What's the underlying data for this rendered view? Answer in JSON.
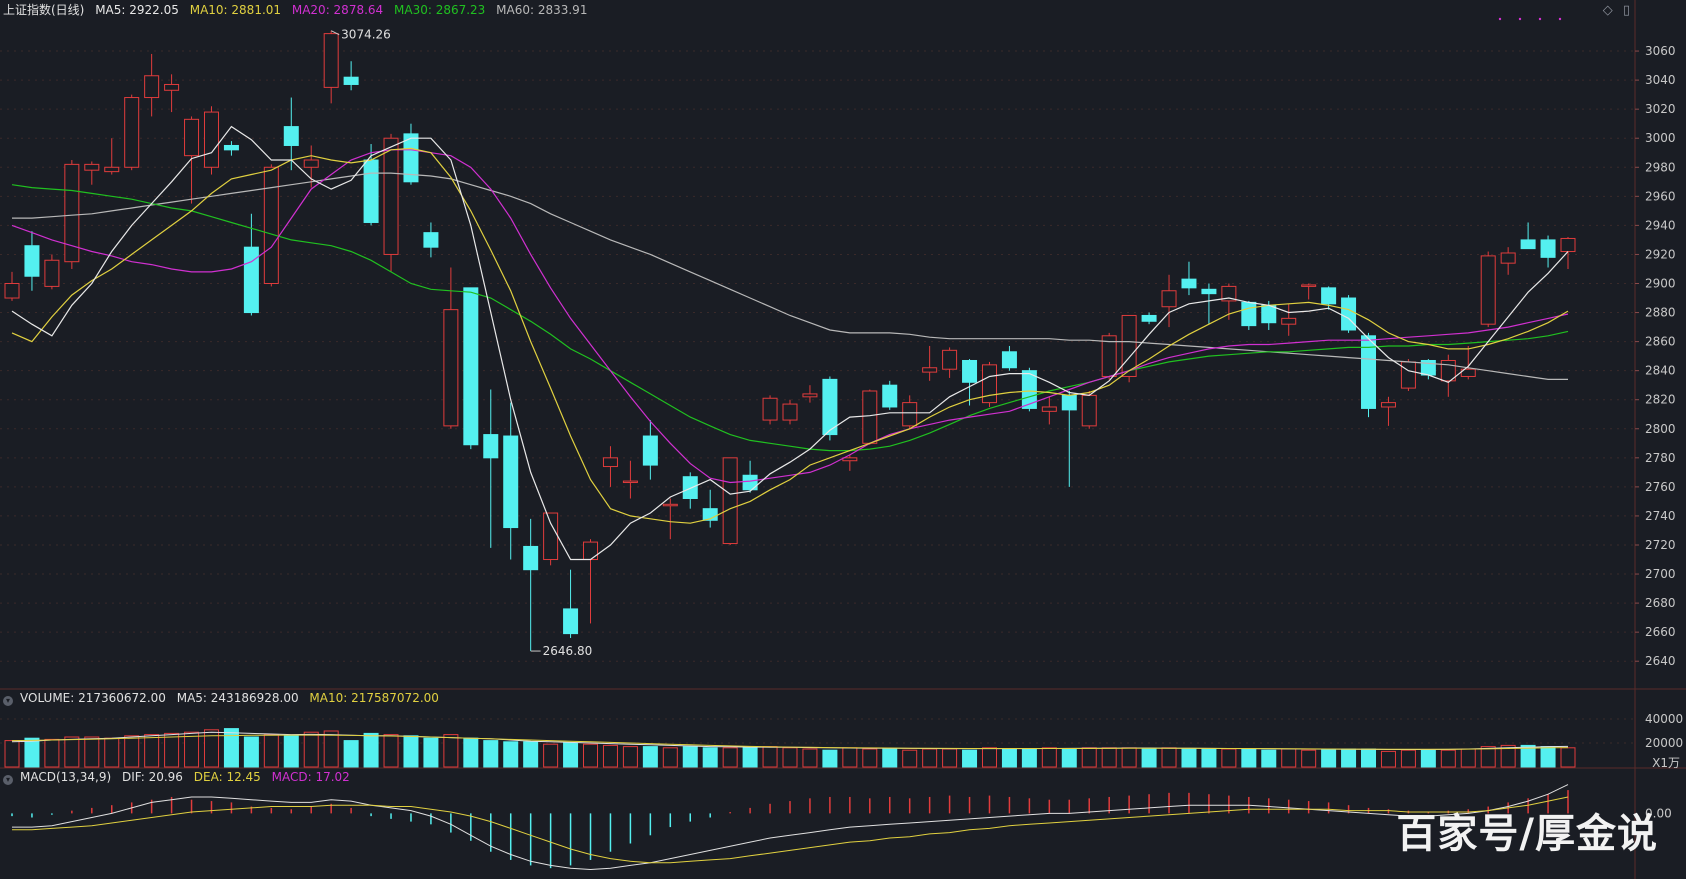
{
  "price_header": {
    "title": "上证指数(日线)",
    "ma5": "MA5: 2922.05",
    "ma10": "MA10: 2881.01",
    "ma20": "MA20: 2878.64",
    "ma30": "MA30: 2867.23",
    "ma60": "MA60: 2833.91"
  },
  "volume_header": {
    "title": "VOLUME: 217360672.00",
    "ma5": "MA5: 243186928.00",
    "ma10": "MA10: 217587072.00",
    "unit": "X1万"
  },
  "macd_header": {
    "title": "MACD(13,34,9)",
    "dif": "DIF: 20.96",
    "dea": "DEA: 12.45",
    "macd": "MACD: 17.02"
  },
  "annotations": {
    "high": "3074.26",
    "low": "2646.80"
  },
  "watermark": "百家号/厚金说",
  "colors": {
    "background": "#1a1d24",
    "up": "#e03c3c",
    "down": "#54f0f0",
    "ma5": "#e8e8e8",
    "ma10": "#e0d040",
    "ma20": "#d030d0",
    "ma30": "#20c020",
    "ma60": "#b8b8b8",
    "grid": "#3a2a2a"
  },
  "chart_data": {
    "type": "candlestick",
    "price_axis": {
      "ylim": [
        2625,
        3080
      ],
      "ticks": [
        3060,
        3040,
        3020,
        3000,
        2980,
        2960,
        2940,
        2920,
        2900,
        2880,
        2860,
        2840,
        2820,
        2800,
        2780,
        2760,
        2740,
        2720,
        2700,
        2680,
        2660,
        2640
      ]
    },
    "volume_axis": {
      "ylim": [
        0,
        50000
      ],
      "ticks": [
        40000,
        20000
      ]
    },
    "macd_axis": {
      "ylim": [
        -45,
        20
      ],
      "ticks": [
        0.0
      ]
    },
    "macd_tick_label": "0.00",
    "candles": [
      {
        "o": 2890,
        "h": 2908,
        "l": 2888,
        "c": 2900
      },
      {
        "o": 2926,
        "h": 2936,
        "l": 2895,
        "c": 2905
      },
      {
        "o": 2898,
        "h": 2920,
        "l": 2896,
        "c": 2916
      },
      {
        "o": 2915,
        "h": 2985,
        "l": 2910,
        "c": 2982
      },
      {
        "o": 2978,
        "h": 2984,
        "l": 2968,
        "c": 2982
      },
      {
        "o": 2977,
        "h": 3000,
        "l": 2975,
        "c": 2980
      },
      {
        "o": 2980,
        "h": 3030,
        "l": 2978,
        "c": 3028
      },
      {
        "o": 3028,
        "h": 3058,
        "l": 3015,
        "c": 3043
      },
      {
        "o": 3033,
        "h": 3044,
        "l": 3018,
        "c": 3037
      },
      {
        "o": 2988,
        "h": 3015,
        "l": 2955,
        "c": 3013
      },
      {
        "o": 2980,
        "h": 3022,
        "l": 2975,
        "c": 3018
      },
      {
        "o": 2995,
        "h": 2998,
        "l": 2988,
        "c": 2992
      },
      {
        "o": 2925,
        "h": 2948,
        "l": 2878,
        "c": 2880
      },
      {
        "o": 2900,
        "h": 2982,
        "l": 2898,
        "c": 2980
      },
      {
        "o": 3008,
        "h": 3028,
        "l": 2978,
        "c": 2995
      },
      {
        "o": 2980,
        "h": 2995,
        "l": 2966,
        "c": 2985
      },
      {
        "o": 3035,
        "h": 3074,
        "l": 3024,
        "c": 3072
      },
      {
        "o": 3042,
        "h": 3053,
        "l": 3033,
        "c": 3037
      },
      {
        "o": 2985,
        "h": 2996,
        "l": 2940,
        "c": 2942
      },
      {
        "o": 2920,
        "h": 3003,
        "l": 2908,
        "c": 3000
      },
      {
        "o": 3003,
        "h": 3010,
        "l": 2968,
        "c": 2970
      },
      {
        "o": 2935,
        "h": 2942,
        "l": 2918,
        "c": 2925
      },
      {
        "o": 2802,
        "h": 2911,
        "l": 2800,
        "c": 2882
      },
      {
        "o": 2897,
        "h": 2897,
        "l": 2786,
        "c": 2789
      },
      {
        "o": 2796,
        "h": 2827,
        "l": 2718,
        "c": 2780
      },
      {
        "o": 2795,
        "h": 2818,
        "l": 2710,
        "c": 2732
      },
      {
        "o": 2719,
        "h": 2738,
        "l": 2647,
        "c": 2703
      },
      {
        "o": 2710,
        "h": 2742,
        "l": 2706,
        "c": 2742
      },
      {
        "o": 2676,
        "h": 2703,
        "l": 2656,
        "c": 2659
      },
      {
        "o": 2710,
        "h": 2724,
        "l": 2666,
        "c": 2722
      },
      {
        "o": 2774,
        "h": 2788,
        "l": 2760,
        "c": 2780
      },
      {
        "o": 2763,
        "h": 2778,
        "l": 2752,
        "c": 2764
      },
      {
        "o": 2795,
        "h": 2806,
        "l": 2765,
        "c": 2775
      },
      {
        "o": 2747,
        "h": 2752,
        "l": 2724,
        "c": 2748
      },
      {
        "o": 2767,
        "h": 2770,
        "l": 2745,
        "c": 2752
      },
      {
        "o": 2745,
        "h": 2758,
        "l": 2732,
        "c": 2737
      },
      {
        "o": 2721,
        "h": 2780,
        "l": 2720,
        "c": 2780
      },
      {
        "o": 2768,
        "h": 2778,
        "l": 2756,
        "c": 2758
      },
      {
        "o": 2806,
        "h": 2823,
        "l": 2803,
        "c": 2821
      },
      {
        "o": 2806,
        "h": 2820,
        "l": 2803,
        "c": 2817
      },
      {
        "o": 2822,
        "h": 2830,
        "l": 2818,
        "c": 2824
      },
      {
        "o": 2834,
        "h": 2836,
        "l": 2792,
        "c": 2796
      },
      {
        "o": 2778,
        "h": 2782,
        "l": 2771,
        "c": 2780
      },
      {
        "o": 2790,
        "h": 2827,
        "l": 2789,
        "c": 2826
      },
      {
        "o": 2830,
        "h": 2833,
        "l": 2813,
        "c": 2815
      },
      {
        "o": 2802,
        "h": 2823,
        "l": 2800,
        "c": 2818
      },
      {
        "o": 2839,
        "h": 2857,
        "l": 2833,
        "c": 2842
      },
      {
        "o": 2841,
        "h": 2856,
        "l": 2835,
        "c": 2854
      },
      {
        "o": 2847,
        "h": 2848,
        "l": 2816,
        "c": 2832
      },
      {
        "o": 2818,
        "h": 2846,
        "l": 2815,
        "c": 2844
      },
      {
        "o": 2853,
        "h": 2857,
        "l": 2840,
        "c": 2842
      },
      {
        "o": 2840,
        "h": 2842,
        "l": 2812,
        "c": 2814
      },
      {
        "o": 2812,
        "h": 2822,
        "l": 2803,
        "c": 2815
      },
      {
        "o": 2823,
        "h": 2826,
        "l": 2760,
        "c": 2813
      },
      {
        "o": 2802,
        "h": 2826,
        "l": 2800,
        "c": 2823
      },
      {
        "o": 2836,
        "h": 2866,
        "l": 2834,
        "c": 2864
      },
      {
        "o": 2836,
        "h": 2878,
        "l": 2832,
        "c": 2878
      },
      {
        "o": 2878,
        "h": 2880,
        "l": 2872,
        "c": 2874
      },
      {
        "o": 2884,
        "h": 2906,
        "l": 2870,
        "c": 2895
      },
      {
        "o": 2903,
        "h": 2915,
        "l": 2892,
        "c": 2897
      },
      {
        "o": 2896,
        "h": 2900,
        "l": 2872,
        "c": 2893
      },
      {
        "o": 2888,
        "h": 2900,
        "l": 2875,
        "c": 2898
      },
      {
        "o": 2887,
        "h": 2888,
        "l": 2868,
        "c": 2871
      },
      {
        "o": 2885,
        "h": 2888,
        "l": 2868,
        "c": 2873
      },
      {
        "o": 2872,
        "h": 2886,
        "l": 2864,
        "c": 2876
      },
      {
        "o": 2898,
        "h": 2900,
        "l": 2889,
        "c": 2899
      },
      {
        "o": 2897,
        "h": 2898,
        "l": 2882,
        "c": 2886
      },
      {
        "o": 2890,
        "h": 2892,
        "l": 2866,
        "c": 2868
      },
      {
        "o": 2864,
        "h": 2866,
        "l": 2808,
        "c": 2814
      },
      {
        "o": 2815,
        "h": 2822,
        "l": 2802,
        "c": 2818
      },
      {
        "o": 2828,
        "h": 2848,
        "l": 2826,
        "c": 2846
      },
      {
        "o": 2847,
        "h": 2848,
        "l": 2834,
        "c": 2837
      },
      {
        "o": 2833,
        "h": 2851,
        "l": 2822,
        "c": 2847
      },
      {
        "o": 2836,
        "h": 2857,
        "l": 2834,
        "c": 2841
      },
      {
        "o": 2872,
        "h": 2922,
        "l": 2870,
        "c": 2919
      },
      {
        "o": 2914,
        "h": 2925,
        "l": 2906,
        "c": 2921
      },
      {
        "o": 2930,
        "h": 2942,
        "l": 2924,
        "c": 2924
      },
      {
        "o": 2930,
        "h": 2933,
        "l": 2911,
        "c": 2918
      },
      {
        "o": 2922,
        "h": 2932,
        "l": 2910,
        "c": 2931
      }
    ],
    "ma5": [
      2881,
      2872,
      2864,
      2885,
      2900,
      2922,
      2940,
      2955,
      2970,
      2986,
      2990,
      3008,
      2999,
      2985,
      2985,
      2972,
      2965,
      2971,
      2988,
      2994,
      3000,
      3000,
      2985,
      2940,
      2880,
      2820,
      2770,
      2735,
      2710,
      2710,
      2720,
      2735,
      2742,
      2753,
      2759,
      2765,
      2755,
      2757,
      2769,
      2777,
      2786,
      2799,
      2808,
      2809,
      2811,
      2811,
      2811,
      2822,
      2829,
      2836,
      2838,
      2838,
      2832,
      2825,
      2823,
      2833,
      2849,
      2865,
      2880,
      2886,
      2888,
      2890,
      2887,
      2885,
      2880,
      2881,
      2883,
      2876,
      2862,
      2849,
      2840,
      2837,
      2832,
      2843,
      2860,
      2877,
      2894,
      2907,
      2922
    ],
    "ma10": [
      2866,
      2860,
      2877,
      2892,
      2902,
      2910,
      2920,
      2930,
      2940,
      2950,
      2962,
      2972,
      2975,
      2978,
      2985,
      2988,
      2985,
      2983,
      2985,
      2992,
      2993,
      2990,
      2973,
      2950,
      2923,
      2895,
      2860,
      2828,
      2795,
      2765,
      2745,
      2740,
      2738,
      2736,
      2735,
      2738,
      2745,
      2750,
      2758,
      2765,
      2775,
      2780,
      2785,
      2790,
      2795,
      2800,
      2808,
      2815,
      2820,
      2823,
      2825,
      2826,
      2825,
      2823,
      2825,
      2830,
      2840,
      2848,
      2857,
      2865,
      2872,
      2879,
      2883,
      2885,
      2886,
      2887,
      2885,
      2882,
      2875,
      2866,
      2860,
      2858,
      2855,
      2855,
      2858,
      2862,
      2867,
      2873,
      2881
    ],
    "ma20": [
      2940,
      2935,
      2930,
      2926,
      2922,
      2919,
      2915,
      2913,
      2910,
      2908,
      2908,
      2910,
      2915,
      2925,
      2945,
      2965,
      2975,
      2985,
      2990,
      2992,
      2992,
      2990,
      2988,
      2980,
      2965,
      2945,
      2920,
      2897,
      2876,
      2858,
      2840,
      2822,
      2805,
      2790,
      2776,
      2766,
      2763,
      2764,
      2766,
      2768,
      2770,
      2775,
      2782,
      2790,
      2796,
      2800,
      2803,
      2806,
      2808,
      2810,
      2812,
      2817,
      2822,
      2827,
      2832,
      2836,
      2840,
      2845,
      2849,
      2852,
      2855,
      2857,
      2858,
      2858,
      2859,
      2860,
      2861,
      2861,
      2861,
      2862,
      2863,
      2864,
      2865,
      2866,
      2868,
      2870,
      2873,
      2876,
      2879
    ],
    "ma30": [
      2968,
      2966,
      2965,
      2964,
      2962,
      2960,
      2958,
      2955,
      2952,
      2950,
      2946,
      2942,
      2938,
      2934,
      2930,
      2928,
      2926,
      2922,
      2916,
      2908,
      2900,
      2896,
      2895,
      2894,
      2890,
      2882,
      2874,
      2865,
      2855,
      2848,
      2840,
      2832,
      2824,
      2816,
      2808,
      2802,
      2796,
      2792,
      2790,
      2788,
      2786,
      2785,
      2785,
      2786,
      2788,
      2792,
      2797,
      2803,
      2809,
      2814,
      2818,
      2822,
      2826,
      2829,
      2832,
      2836,
      2840,
      2843,
      2846,
      2848,
      2850,
      2851,
      2852,
      2853,
      2853,
      2854,
      2855,
      2856,
      2856,
      2857,
      2857,
      2858,
      2858,
      2859,
      2860,
      2861,
      2862,
      2864,
      2867
    ],
    "ma60": [
      2945,
      2945,
      2946,
      2947,
      2948,
      2950,
      2952,
      2954,
      2956,
      2958,
      2960,
      2962,
      2964,
      2966,
      2968,
      2970,
      2972,
      2974,
      2976,
      2976,
      2975,
      2974,
      2972,
      2968,
      2964,
      2960,
      2955,
      2948,
      2942,
      2936,
      2930,
      2925,
      2920,
      2914,
      2908,
      2902,
      2896,
      2890,
      2884,
      2878,
      2873,
      2868,
      2866,
      2866,
      2866,
      2865,
      2863,
      2862,
      2862,
      2862,
      2862,
      2862,
      2862,
      2861,
      2861,
      2860,
      2860,
      2859,
      2858,
      2857,
      2856,
      2855,
      2854,
      2853,
      2852,
      2851,
      2850,
      2849,
      2848,
      2847,
      2846,
      2845,
      2844,
      2842,
      2840,
      2838,
      2836,
      2834,
      2834
    ],
    "volume": [
      22000,
      24000,
      23000,
      25000,
      25000,
      24000,
      26000,
      27000,
      28000,
      29000,
      31000,
      32000,
      25000,
      27000,
      26000,
      29000,
      30000,
      22000,
      28000,
      27000,
      26000,
      24000,
      27000,
      24000,
      22000,
      21000,
      21000,
      19000,
      20000,
      19000,
      18000,
      17000,
      17000,
      16000,
      17000,
      16000,
      16000,
      16000,
      17000,
      16000,
      15000,
      14000,
      16000,
      15000,
      15000,
      14000,
      15000,
      15000,
      14000,
      16000,
      15000,
      15000,
      16000,
      15000,
      16000,
      16000,
      16000,
      15000,
      16000,
      15000,
      15000,
      15000,
      15000,
      14000,
      15000,
      14000,
      15000,
      15000,
      15000,
      13000,
      14000,
      14000,
      14000,
      15000,
      17000,
      18000,
      18000,
      17000,
      16000
    ],
    "vol_ma5": [
      21000,
      21500,
      22500,
      23000,
      23500,
      24000,
      25000,
      26000,
      27000,
      28000,
      29000,
      28500,
      28000,
      27500,
      27000,
      27200,
      27000,
      26500,
      26000,
      26000,
      25500,
      25000,
      24500,
      24000,
      23500,
      22500,
      21500,
      21000,
      20500,
      20000,
      19500,
      19000,
      18500,
      18000,
      17500,
      17000,
      16800,
      16600,
      16500,
      16400,
      16200,
      16000,
      15800,
      15700,
      15600,
      15500,
      15400,
      15300,
      15300,
      15300,
      15300,
      15300,
      15400,
      15500,
      15600,
      15700,
      15800,
      15800,
      15700,
      15600,
      15500,
      15400,
      15300,
      15200,
      15100,
      15000,
      14900,
      14800,
      14700,
      14600,
      14600,
      14600,
      14700,
      15000,
      15500,
      16000,
      16500,
      17000,
      17200
    ],
    "vol_ma10": [
      22000,
      22200,
      22500,
      22800,
      23200,
      23600,
      24000,
      24500,
      25000,
      25500,
      26000,
      26200,
      26400,
      26500,
      26600,
      26600,
      26500,
      26300,
      26000,
      25800,
      25500,
      25000,
      24500,
      24000,
      23500,
      23000,
      22500,
      22000,
      21500,
      21000,
      20500,
      20000,
      19500,
      19000,
      18500,
      18000,
      17600,
      17200,
      16900,
      16600,
      16400,
      16200,
      16000,
      15900,
      15800,
      15700,
      15600,
      15500,
      15450,
      15400,
      15400,
      15400,
      15400,
      15400,
      15450,
      15500,
      15550,
      15600,
      15600,
      15550,
      15500,
      15450,
      15400,
      15300,
      15200,
      15100,
      15000,
      14950,
      14900,
      14850,
      14800,
      14800,
      14800,
      14900,
      15100,
      15400,
      15700,
      16000,
      16200
    ],
    "macd_bars": [
      -2,
      -3,
      -1,
      2,
      4,
      6,
      8,
      10,
      12,
      10,
      9,
      8,
      5,
      4,
      3,
      5,
      7,
      4,
      -2,
      -4,
      -6,
      -8,
      -14,
      -20,
      -28,
      -34,
      -38,
      -40,
      -38,
      -34,
      -28,
      -22,
      -16,
      -10,
      -6,
      -3,
      1,
      4,
      7,
      9,
      11,
      12,
      12,
      11,
      12,
      11,
      12,
      13,
      12,
      13,
      12,
      11,
      10,
      10,
      11,
      12,
      13,
      14,
      15,
      15,
      14,
      13,
      12,
      11,
      10,
      9,
      8,
      6,
      4,
      3,
      2,
      1,
      2,
      3,
      5,
      8,
      11,
      14,
      17
    ],
    "dif": [
      -10,
      -10,
      -9,
      -6,
      -3,
      0,
      4,
      8,
      10,
      12,
      12,
      11,
      10,
      9,
      8,
      8,
      10,
      9,
      6,
      4,
      2,
      -2,
      -8,
      -16,
      -24,
      -30,
      -35,
      -38,
      -40,
      -41,
      -40,
      -38,
      -36,
      -33,
      -30,
      -27,
      -24,
      -21,
      -18,
      -16,
      -14,
      -12,
      -10,
      -9,
      -8,
      -7,
      -6,
      -5,
      -4,
      -3,
      -2,
      -1,
      0,
      0,
      1,
      2,
      3,
      4,
      5,
      6,
      6,
      6,
      6,
      5,
      4,
      3,
      2,
      1,
      0,
      -1,
      -2,
      -2,
      -1,
      0,
      2,
      5,
      9,
      14,
      21
    ],
    "dea": [
      -12,
      -12,
      -11,
      -10,
      -9,
      -7,
      -5,
      -3,
      -1,
      1,
      2,
      3,
      4,
      5,
      5,
      5,
      6,
      6,
      6,
      5,
      5,
      3,
      1,
      -2,
      -6,
      -11,
      -16,
      -21,
      -26,
      -30,
      -33,
      -35,
      -36,
      -36,
      -35,
      -34,
      -33,
      -31,
      -29,
      -27,
      -25,
      -23,
      -21,
      -20,
      -18,
      -17,
      -15,
      -14,
      -12,
      -11,
      -9,
      -8,
      -7,
      -6,
      -5,
      -4,
      -3,
      -2,
      -1,
      0,
      1,
      2,
      3,
      3,
      3,
      3,
      3,
      2,
      2,
      2,
      1,
      1,
      1,
      1,
      2,
      4,
      6,
      9,
      12
    ]
  }
}
